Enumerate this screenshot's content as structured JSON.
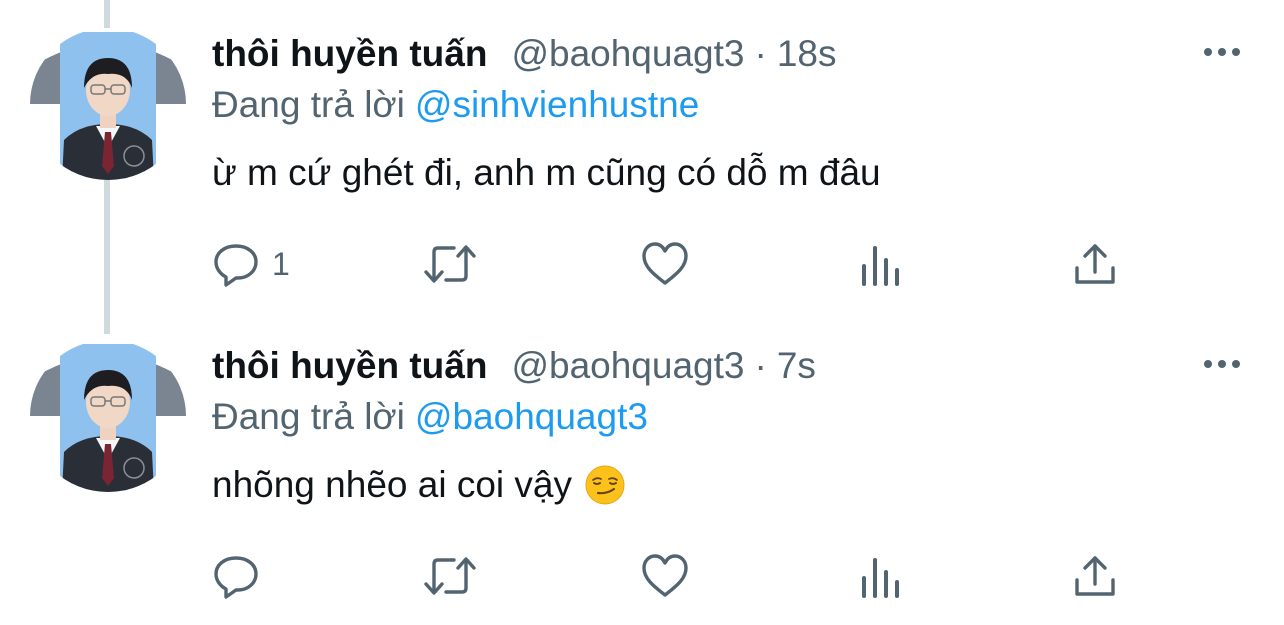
{
  "tweets": [
    {
      "display_name": "thôi huyền tuấn",
      "handle": "@baohquagt3",
      "separator": "·",
      "time": "18s",
      "reply_prefix": "Đang trả lời",
      "reply_to": "@sinhvienhustne",
      "text": "ừ m cứ ghét đi, anh m cũng có dỗ m đâu",
      "reply_count": "1",
      "emoji": null
    },
    {
      "display_name": "thôi huyền tuấn",
      "handle": "@baohquagt3",
      "separator": "·",
      "time": "7s",
      "reply_prefix": "Đang trả lời",
      "reply_to": "@baohquagt3",
      "text": "nhõng nhẽo ai coi vậy",
      "reply_count": "",
      "emoji": "smirking-face"
    }
  ],
  "icons": {
    "reply": "reply-icon",
    "retweet": "retweet-icon",
    "like": "like-icon",
    "views": "views-icon",
    "share": "share-icon",
    "more": "more-icon"
  },
  "colors": {
    "text_primary": "#0f1419",
    "text_secondary": "#536471",
    "mention": "#1d9bf0",
    "thread_line": "#cfd9de",
    "avatar_bg": "#8fc1ef"
  }
}
